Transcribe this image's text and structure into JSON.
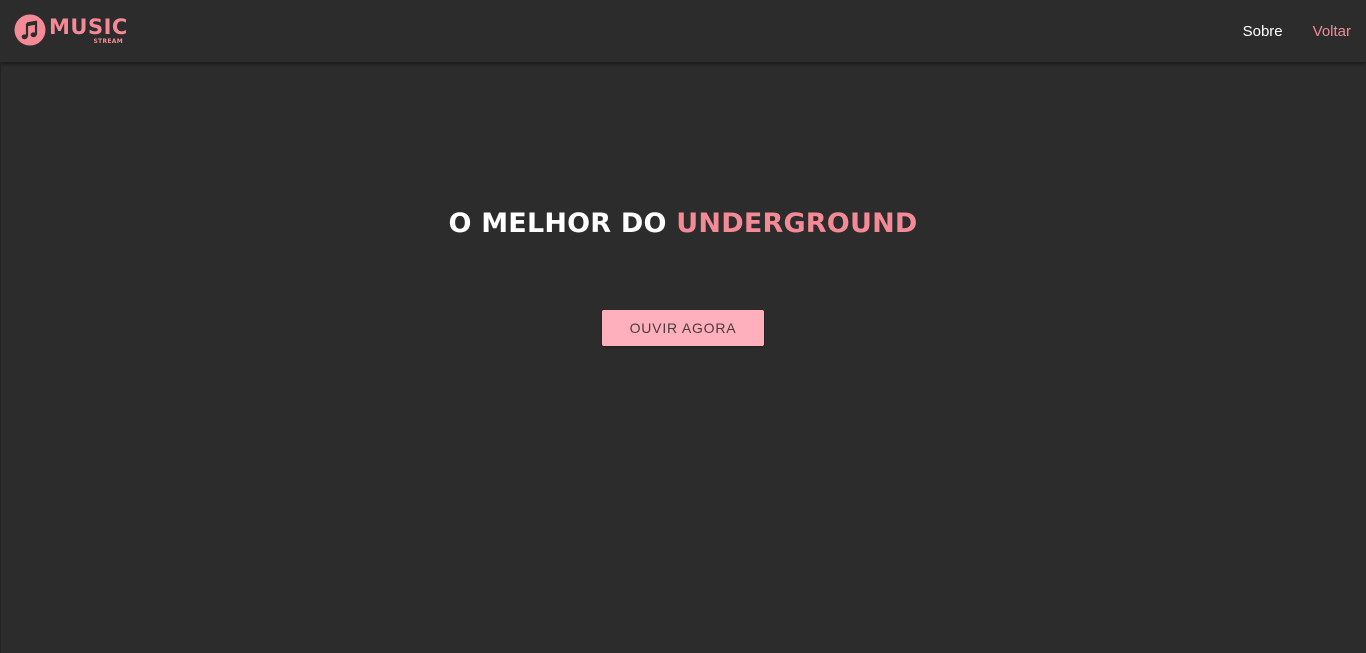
{
  "colors": {
    "background": "#2c2c2c",
    "accent": "#f48a96",
    "button_bg": "#ffb0bc",
    "text_light": "#ffffff"
  },
  "header": {
    "logo": {
      "icon": "music-note-icon",
      "main": "MUSIC",
      "sub": "STREAM"
    },
    "nav": {
      "sobre": "Sobre",
      "voltar": "Voltar"
    }
  },
  "hero": {
    "title_prefix": "O MELHOR DO",
    "title_accent": "UNDERGROUND",
    "button_label": "OUVIR AGORA"
  }
}
